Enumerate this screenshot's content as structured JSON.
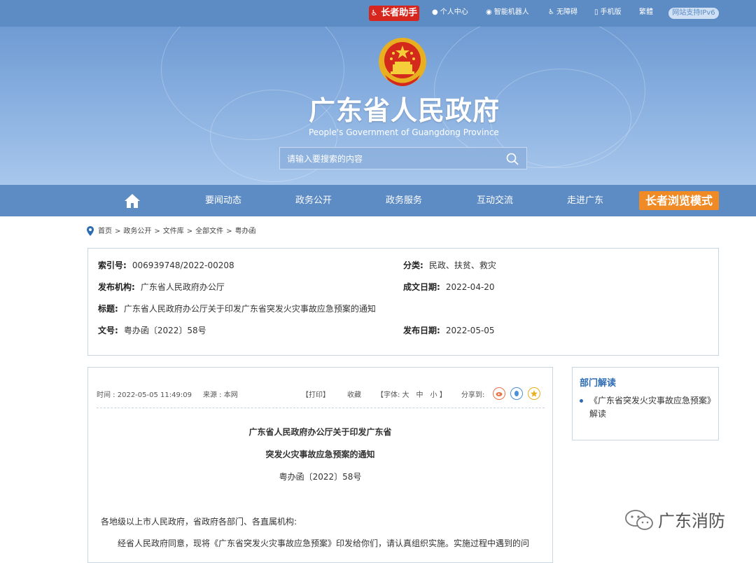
{
  "topbar": {
    "elder_helper": "长者助手",
    "links": [
      "个人中心",
      "智能机器人",
      "无障碍",
      "手机版",
      "繁體"
    ],
    "ipv6": "网站支持IPv6"
  },
  "header": {
    "title": "广东省人民政府",
    "subtitle": "People's Government of Guangdong Province",
    "search_placeholder": "请输入要搜索的内容"
  },
  "nav": {
    "items": [
      "要闻动态",
      "政务公开",
      "政务服务",
      "互动交流",
      "走进广东"
    ],
    "elder_mode": "长者浏览模式"
  },
  "breadcrumb": [
    "首页",
    "政务公开",
    "文件库",
    "全部文件",
    "粤办函"
  ],
  "meta": {
    "index_label": "索引号:",
    "index_value": "006939748/2022-00208",
    "category_label": "分类:",
    "category_value": "民政、扶贫、救灾",
    "org_label": "发布机构:",
    "org_value": "广东省人民政府办公厅",
    "written_label": "成文日期:",
    "written_value": "2022-04-20",
    "title_label": "标题:",
    "title_value": "广东省人民政府办公厅关于印发广东省突发火灾事故应急预案的通知",
    "docno_label": "文号:",
    "docno_value": "粤办函〔2022〕58号",
    "pub_label": "发布日期:",
    "pub_value": "2022-05-05"
  },
  "article": {
    "time": "时间 : 2022-05-05 11:49:09",
    "source": "来源 : 本网",
    "print": "【打印】",
    "favorite": "收藏",
    "font_size": "【字体: 大　中　小 】",
    "share": "分享到:",
    "title_line1": "广东省人民政府办公厅关于印发广东省",
    "title_line2": "突发火灾事故应急预案的通知",
    "doc_no": "粤办函〔2022〕58号",
    "salutation": "各地级以上市人民政府，省政府各部门、各直属机构:",
    "body1": "经省人民政府同意，现将《广东省突发火灾事故应急预案》印发给你们，请认真组织实施。实施过程中遇到的问"
  },
  "sidebar": {
    "heading": "部门解读",
    "item": "《广东省突发火灾事故应急预案》解读"
  },
  "watermark": {
    "text": "广东消防"
  },
  "colors": {
    "brand_blue": "#5d8bc4",
    "elder_red": "#d7261e",
    "elder_orange": "#f08a24"
  }
}
